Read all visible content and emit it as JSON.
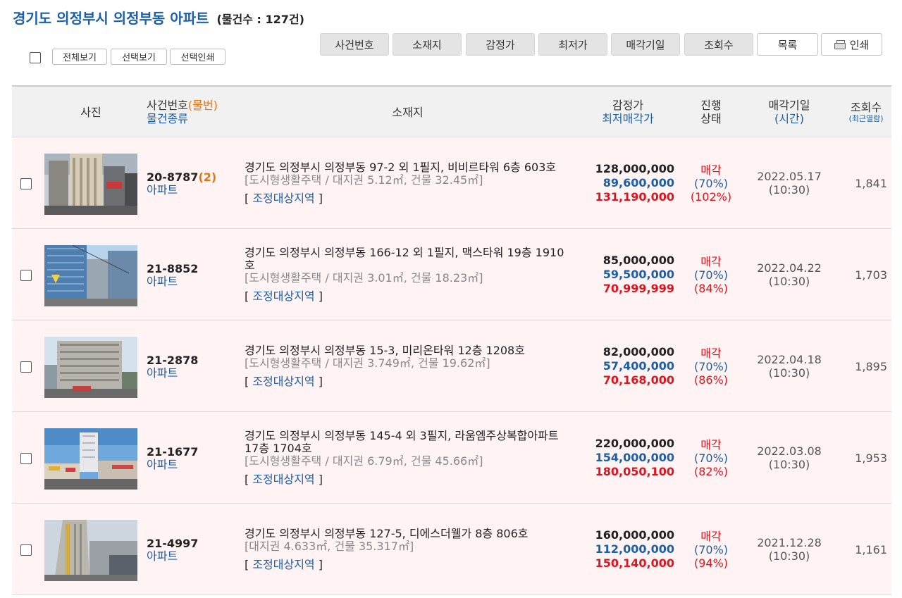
{
  "header": {
    "title": "경기도 의정부시 의정부동 아파트",
    "count_text": "(물건수 : 127건)"
  },
  "toolbar": {
    "small_buttons": [
      "전체보기",
      "선택보기",
      "선택인쇄"
    ],
    "sort_buttons": [
      "사건번호",
      "소재지",
      "감정가",
      "최저가",
      "매각기일",
      "조회수"
    ],
    "list_button": "목록",
    "print_button": "인쇄"
  },
  "table_header": {
    "photo": "사진",
    "case_no": "사건번호",
    "case_sub": "(물번)",
    "item_type": "물건종류",
    "location": "소재지",
    "appraisal": "감정가",
    "min_price": "최저매각가",
    "status_1": "진행",
    "status_2": "상태",
    "sale_date": "매각기일",
    "sale_time": "(시간)",
    "views": "조회수",
    "views_sub": "(최근열람)"
  },
  "rows": [
    {
      "case_no": "20-8787",
      "case_sub": "(2)",
      "type": "아파트",
      "address": "경기도 의정부시 의정부동 97-2 외 1필지, 비비르타워 6층 603호",
      "detail": "[도시형생활주택 / 대지권 5.12㎡, 건물 32.45㎡]",
      "zone_open": "[ ",
      "zone": "조정대상지역",
      "zone_close": " ]",
      "appraisal": "128,000,000",
      "min_price": "89,600,000",
      "sold_price": "131,190,000",
      "status": "매각",
      "min_rate": "(70%)",
      "sold_rate": "(102%)",
      "date": "2022.05.17",
      "time": "(10:30)",
      "views": "1,841"
    },
    {
      "case_no": "21-8852",
      "case_sub": "",
      "type": "아파트",
      "address": "경기도 의정부시 의정부동 166-12 외 1필지, 맥스타워 19층 1910호",
      "detail": "[도시형생활주택 / 대지권 3.01㎡, 건물 18.23㎡]",
      "zone_open": "[ ",
      "zone": "조정대상지역",
      "zone_close": " ]",
      "appraisal": "85,000,000",
      "min_price": "59,500,000",
      "sold_price": "70,999,999",
      "status": "매각",
      "min_rate": "(70%)",
      "sold_rate": "(84%)",
      "date": "2022.04.22",
      "time": "(10:30)",
      "views": "1,703"
    },
    {
      "case_no": "21-2878",
      "case_sub": "",
      "type": "아파트",
      "address": "경기도 의정부시 의정부동 15-3, 미리온타워 12층 1208호",
      "detail": "[도시형생활주택 / 대지권 3.749㎡, 건물 19.62㎡]",
      "zone_open": "[ ",
      "zone": "조정대상지역",
      "zone_close": " ]",
      "appraisal": "82,000,000",
      "min_price": "57,400,000",
      "sold_price": "70,168,000",
      "status": "매각",
      "min_rate": "(70%)",
      "sold_rate": "(86%)",
      "date": "2022.04.18",
      "time": "(10:30)",
      "views": "1,895"
    },
    {
      "case_no": "21-1677",
      "case_sub": "",
      "type": "아파트",
      "address": "경기도 의정부시 의정부동 145-4 외 3필지, 라움엠주상복합아파트 17층 1704호",
      "detail": "[도시형생활주택 / 대지권 6.79㎡, 건물 45.66㎡]",
      "zone_open": "[ ",
      "zone": "조정대상지역",
      "zone_close": " ]",
      "appraisal": "220,000,000",
      "min_price": "154,000,000",
      "sold_price": "180,050,100",
      "status": "매각",
      "min_rate": "(70%)",
      "sold_rate": "(82%)",
      "date": "2022.03.08",
      "time": "(10:30)",
      "views": "1,953"
    },
    {
      "case_no": "21-4997",
      "case_sub": "",
      "type": "아파트",
      "address": "경기도 의정부시 의정부동 127-5, 디에스더웰가 8층 806호",
      "detail": "[대지권 4.633㎡, 건물 35.317㎡]",
      "zone_open": "[ ",
      "zone": "조정대상지역",
      "zone_close": " ]",
      "appraisal": "160,000,000",
      "min_price": "112,000,000",
      "sold_price": "150,140,000",
      "status": "매각",
      "min_rate": "(70%)",
      "sold_rate": "(94%)",
      "date": "2021.12.28",
      "time": "(10:30)",
      "views": "1,161"
    }
  ]
}
